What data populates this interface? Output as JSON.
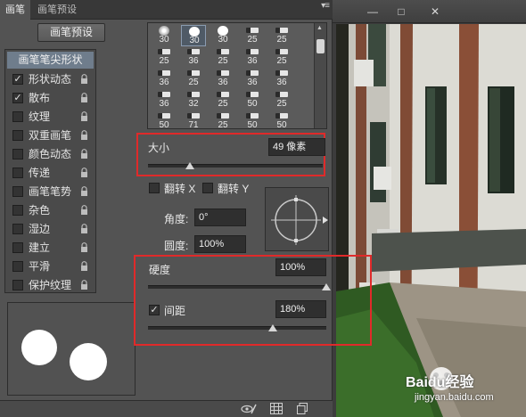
{
  "panel": {
    "tabs": [
      {
        "label": "画笔",
        "active": true
      },
      {
        "label": "画笔预设",
        "active": false
      }
    ],
    "menu_icon": "≡",
    "preset_button": "画笔预设"
  },
  "options_list": {
    "header": "画笔笔尖形状",
    "items": [
      {
        "label": "形状动态",
        "checked": true
      },
      {
        "label": "散布",
        "checked": true
      },
      {
        "label": "纹理",
        "checked": false
      },
      {
        "label": "双重画笔",
        "checked": false
      },
      {
        "label": "颜色动态",
        "checked": false
      },
      {
        "label": "传递",
        "checked": false
      },
      {
        "label": "画笔笔势",
        "checked": false
      },
      {
        "label": "杂色",
        "checked": false
      },
      {
        "label": "湿边",
        "checked": false
      },
      {
        "label": "建立",
        "checked": false
      },
      {
        "label": "平滑",
        "checked": false
      },
      {
        "label": "保护纹理",
        "checked": false
      }
    ]
  },
  "brush_tips": {
    "rows": [
      [
        "30",
        "30",
        "30",
        "25",
        "25"
      ],
      [
        "25",
        "36",
        "25",
        "36",
        "25"
      ],
      [
        "36",
        "25",
        "36",
        "36",
        "36"
      ],
      [
        "36",
        "32",
        "25",
        "50",
        "25"
      ],
      [
        "50",
        "71",
        "25",
        "50",
        "50"
      ]
    ],
    "selected": "30"
  },
  "size": {
    "label": "大小",
    "value": "49 像素",
    "level": 0.24
  },
  "flip": {
    "x_label": "翻转 X",
    "y_label": "翻转 Y"
  },
  "angle": {
    "label": "角度:",
    "value": "0°"
  },
  "roundness": {
    "label": "圆度:",
    "value": "100%"
  },
  "hardness": {
    "label": "硬度",
    "value": "100%",
    "level": 1.0
  },
  "spacing": {
    "label": "间距",
    "value": "180%",
    "checked": true,
    "level": 0.7
  },
  "bottom_icons": [
    "eye-brush-icon",
    "grid-icon",
    "new-page-icon"
  ],
  "window": {
    "minimize": "—",
    "maximize": "□",
    "close": "✕"
  },
  "watermark": {
    "text": "Baidu经验",
    "url": "jingyan.baidu.com"
  },
  "colors": {
    "panel_bg": "#535353",
    "highlight": "#e02a2a",
    "list_header": "#6f7d8c"
  }
}
